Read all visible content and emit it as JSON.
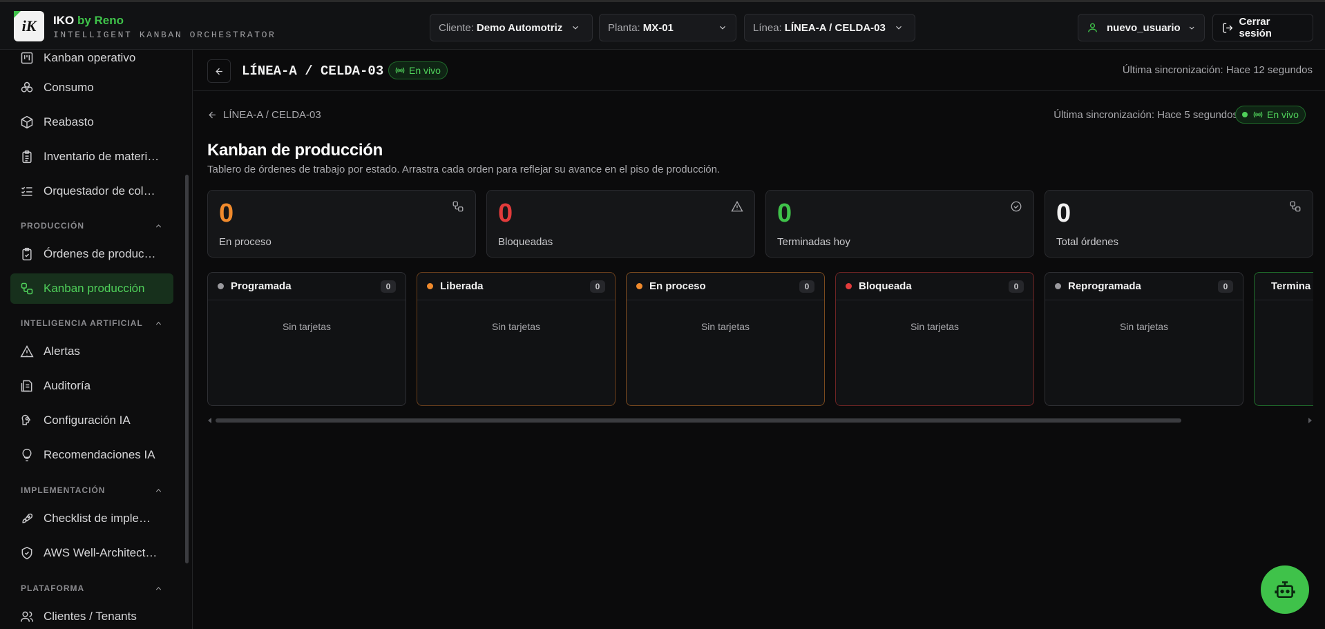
{
  "brand": {
    "logo_text": "iK",
    "name": "IKO",
    "name_accent": "by Reno",
    "subtitle": "INTELLIGENT KANBAN ORCHESTRATOR"
  },
  "filters": {
    "cliente": {
      "label": "Cliente:",
      "value": "Demo Automotriz"
    },
    "planta": {
      "label": "Planta:",
      "value": "MX-01"
    },
    "linea": {
      "label": "Línea:",
      "value": "LÍNEA-A / CELDA-03"
    }
  },
  "user": {
    "name": "nuevo_usuario"
  },
  "logout_label": "Cerrar sesión",
  "sidebar": {
    "items_top": [
      {
        "label": "Kanban operativo",
        "icon": "kanban-icon"
      },
      {
        "label": "Consumo",
        "icon": "boxes-icon"
      },
      {
        "label": "Reabasto",
        "icon": "package-icon"
      },
      {
        "label": "Inventario de materi…",
        "icon": "clipboard-list-icon"
      },
      {
        "label": "Orquestador de col…",
        "icon": "list-checks-icon"
      }
    ],
    "sections": [
      {
        "title": "PRODUCCIÓN",
        "items": [
          {
            "label": "Órdenes de produc…",
            "icon": "clipboard-check-icon"
          },
          {
            "label": "Kanban producción",
            "icon": "workflow-icon",
            "active": true
          }
        ]
      },
      {
        "title": "INTELIGENCIA ARTIFICIAL",
        "items": [
          {
            "label": "Alertas",
            "icon": "alert-triangle-icon"
          },
          {
            "label": "Auditoría",
            "icon": "audit-icon"
          },
          {
            "label": "Configuración IA",
            "icon": "brain-cog-icon"
          },
          {
            "label": "Recomendaciones IA",
            "icon": "lightbulb-icon"
          }
        ]
      },
      {
        "title": "IMPLEMENTACIÓN",
        "items": [
          {
            "label": "Checklist de imple…",
            "icon": "rocket-icon"
          },
          {
            "label": "AWS Well-Architect…",
            "icon": "shield-check-icon"
          }
        ]
      },
      {
        "title": "PLATAFORMA",
        "items": [
          {
            "label": "Clientes / Tenants",
            "icon": "users-icon"
          }
        ]
      }
    ]
  },
  "subheader": {
    "title": "LÍNEA-A / CELDA-03",
    "live_label": "En vivo",
    "sync": "Última sincronización: Hace 12 segundos"
  },
  "page": {
    "breadcrumb": "LÍNEA-A / CELDA-03",
    "sync": "Última sincronización: Hace 5 segundos",
    "live_label": "En vivo",
    "title": "Kanban de producción",
    "description": "Tablero de órdenes de trabajo por estado. Arrastra cada orden para reflejar su avance en el piso de producción."
  },
  "stats": [
    {
      "value": "0",
      "label": "En proceso",
      "color": "#f08a2c",
      "icon": "workflow-icon"
    },
    {
      "value": "0",
      "label": "Bloqueadas",
      "color": "#e23b3b",
      "icon": "alert-triangle-icon"
    },
    {
      "value": "0",
      "label": "Terminadas hoy",
      "color": "#3fc24a",
      "icon": "check-circle-icon"
    },
    {
      "value": "0",
      "label": "Total órdenes",
      "color": "#f2f2f2",
      "icon": "workflow-icon"
    }
  ],
  "columns": [
    {
      "title": "Programada",
      "count": "0",
      "dot": "#9a9a9e",
      "border": "#2f3034",
      "empty": "Sin tarjetas"
    },
    {
      "title": "Liberada",
      "count": "0",
      "dot": "#f08a2c",
      "border": "#6a3f1c",
      "empty": "Sin tarjetas"
    },
    {
      "title": "En proceso",
      "count": "0",
      "dot": "#f08a2c",
      "border": "#7a4a1e",
      "empty": "Sin tarjetas"
    },
    {
      "title": "Bloqueada",
      "count": "0",
      "dot": "#e23b3b",
      "border": "#6e2424",
      "empty": "Sin tarjetas"
    },
    {
      "title": "Reprogramada",
      "count": "0",
      "dot": "#9a9a9e",
      "border": "#2f3034",
      "empty": "Sin tarjetas"
    },
    {
      "title": "Termina",
      "count": "",
      "dot": "#3fc24a",
      "border": "#1f6a2a",
      "empty": ""
    }
  ]
}
